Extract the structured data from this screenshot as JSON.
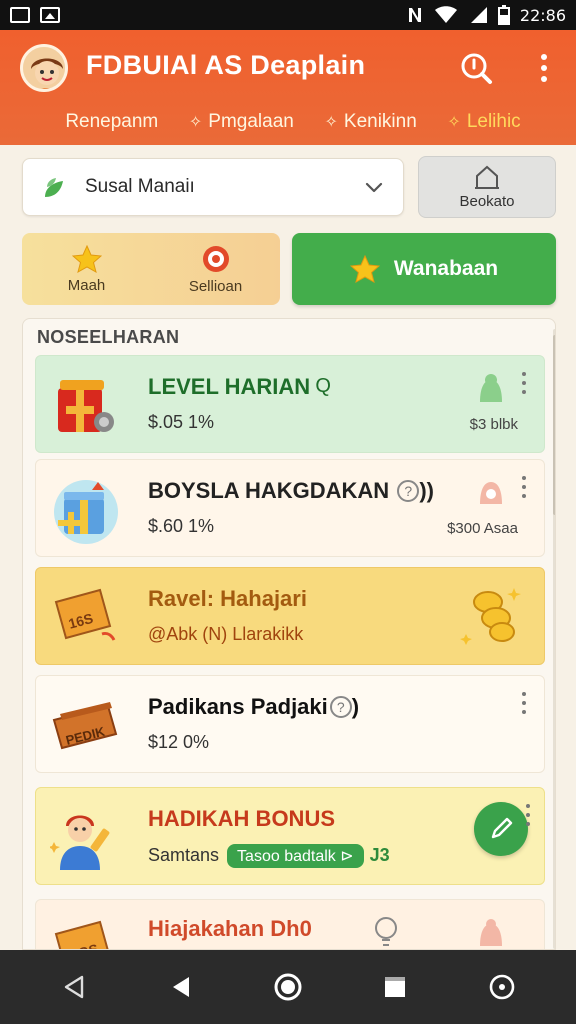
{
  "status_bar": {
    "time": "22:86",
    "icons": [
      "notification-icon",
      "image-icon",
      "nfc-icon",
      "wifi-icon",
      "signal-icon",
      "battery-icon"
    ]
  },
  "header": {
    "title": "FDBUIAl AS Deaplain",
    "tabs": [
      {
        "label": "Renepanm",
        "icon": ""
      },
      {
        "label": "Pmgalaan",
        "icon": "sparkle-icon"
      },
      {
        "label": "Kenikinn",
        "icon": "sparkle-icon"
      },
      {
        "label": "Lelihic",
        "icon": "sparkle-icon",
        "active": true
      }
    ],
    "accent": "#ee6535"
  },
  "filter": {
    "selected": "Susal Manaiı",
    "side_button_label": "Beokato"
  },
  "actions": {
    "left": {
      "label": "Maah",
      "icon": "star-icon"
    },
    "right": {
      "label": "Sellioan",
      "icon": "target-icon"
    },
    "primary": {
      "label": "Wanabaan",
      "icon": "star-icon",
      "color": "#43ad4b"
    }
  },
  "section": {
    "title": "NOSEELHARAN"
  },
  "cards": [
    {
      "title": "LEVEL HARIAN",
      "sub": "$.05 1%",
      "right": "$3 blbk",
      "icon": "gift-box-icon"
    },
    {
      "title": "BOYSLA HAKGDAKAN",
      "sub": "$.60 1%",
      "right": "$300 Asaa",
      "icon": "gift-box-icon"
    },
    {
      "title": "Ravel: Hahajari",
      "sub": "@Abk (N) Llarakikk",
      "right": "",
      "icon": "ticket-icon"
    },
    {
      "title": "Padikans Padjaki",
      "sub": "$12 0%",
      "right": "",
      "icon": "coupon-icon"
    },
    {
      "title": "HADIKAH BONUS",
      "sub": "Samtans",
      "pill": "Tasoo badtalk",
      "pill_tail": "J3",
      "icon": "character-icon"
    },
    {
      "title": "Hiajakahan Dh0",
      "sub": "",
      "right": "",
      "icon": "ticket-icon"
    }
  ]
}
